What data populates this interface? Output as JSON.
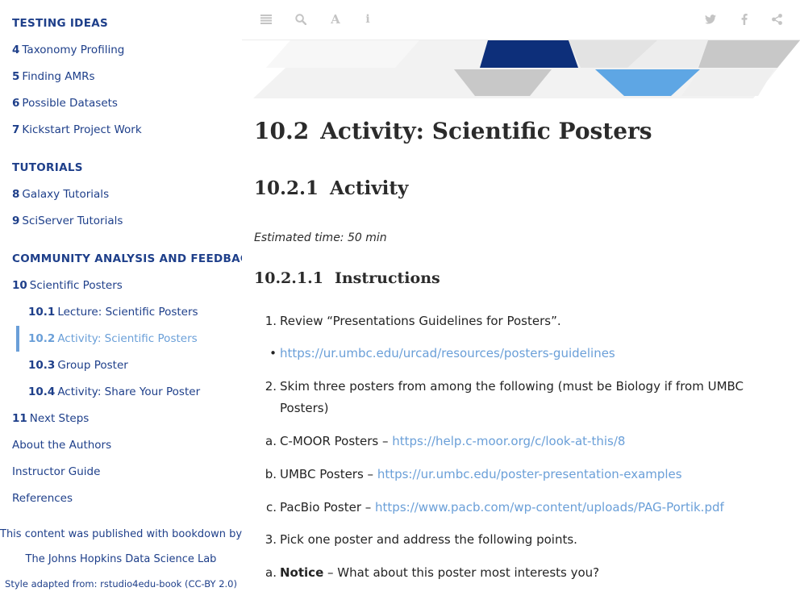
{
  "sidebar": {
    "sections": [
      {
        "label": "TESTING IDEAS"
      },
      {
        "label": "TUTORIALS"
      },
      {
        "label": "COMMUNITY ANALYSIS AND FEEDBACK"
      }
    ],
    "items": [
      {
        "num": "4",
        "label": "Taxonomy Profiling"
      },
      {
        "num": "5",
        "label": "Finding AMRs"
      },
      {
        "num": "6",
        "label": "Possible Datasets"
      },
      {
        "num": "7",
        "label": "Kickstart Project Work"
      },
      {
        "num": "8",
        "label": "Galaxy Tutorials"
      },
      {
        "num": "9",
        "label": "SciServer Tutorials"
      },
      {
        "num": "10",
        "label": "Scientific Posters"
      },
      {
        "num": "10.1",
        "label": "Lecture: Scientific Posters"
      },
      {
        "num": "10.2",
        "label": "Activity: Scientific Posters"
      },
      {
        "num": "10.3",
        "label": "Group Poster"
      },
      {
        "num": "10.4",
        "label": "Activity: Share Your Poster"
      },
      {
        "num": "11",
        "label": "Next Steps"
      },
      {
        "num": "",
        "label": "About the Authors"
      },
      {
        "num": "",
        "label": "Instructor Guide"
      },
      {
        "num": "",
        "label": "References"
      }
    ],
    "publisher": "This content was published with bookdown by:",
    "lab": "The Johns Hopkins Data Science Lab",
    "style_note": "Style adapted from: rstudio4edu-book (CC-BY 2.0)"
  },
  "toolbar": {
    "left_icons": [
      "toc-toggle-icon",
      "search-icon",
      "font-settings-icon",
      "info-icon"
    ],
    "right_icons": [
      "twitter-icon",
      "facebook-icon",
      "share-icon"
    ],
    "font_glyph": "A",
    "info_glyph": "i"
  },
  "content": {
    "h2_num": "10.2",
    "h2_title": "Activity: Scientific Posters",
    "h3_num": "10.2.1",
    "h3_title": "Activity",
    "estimated_time": "Estimated time: 50 min",
    "h4_num": "10.2.1.1",
    "h4_title": "Instructions",
    "list": [
      {
        "marker": "1.",
        "text": "Review “Presentations Guidelines for Posters”."
      },
      {
        "marker": "•",
        "link": "https://ur.umbc.edu/urcad/resources/posters-guidelines"
      },
      {
        "marker": "2.",
        "text": "Skim three posters from among the following (must be Biology if from UMBC",
        "text2": "Posters)"
      },
      {
        "marker": "a.",
        "text": "C-MOOR Posters – ",
        "link": "https://help.c-moor.org/c/look-at-this/8"
      },
      {
        "marker": "b.",
        "text": "UMBC Posters – ",
        "link": "https://ur.umbc.edu/poster-presentation-examples"
      },
      {
        "marker": "c.",
        "text": "PacBio Poster – ",
        "link": "https://www.pacb.com/wp-content/uploads/PAG-Portik.pdf"
      },
      {
        "marker": "3.",
        "text": "Pick one poster and address the following points."
      },
      {
        "marker": "a.",
        "bold": "Notice",
        "text": " – What about this poster most interests you?"
      }
    ]
  },
  "colors": {
    "nav": "#1e3f8a",
    "active": "#6a9fd8",
    "link": "#6a9fd8",
    "banner_navy": "#0d2f7a",
    "banner_blue": "#5ea6e4",
    "banner_grey": "#c8c8c8"
  }
}
